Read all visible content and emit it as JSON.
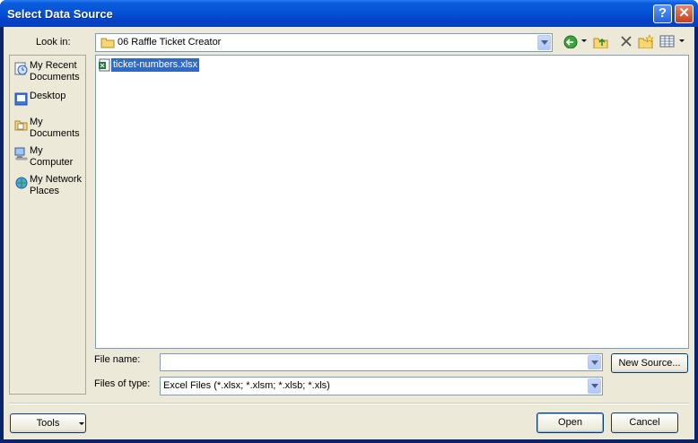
{
  "window": {
    "title": "Select Data Source",
    "help_label": "?",
    "close_label": "✕"
  },
  "look_in": {
    "label": "Look in:",
    "value": "06 Raffle Ticket Creator",
    "icon": "folder-icon"
  },
  "toolbar": {
    "back": "back-icon",
    "up": "up-folder-icon",
    "delete": "delete-icon",
    "new_folder": "new-folder-icon",
    "views": "views-icon"
  },
  "places_bar": [
    {
      "label": "My Recent Documents",
      "icon": "recent-documents-icon"
    },
    {
      "label": "Desktop",
      "icon": "desktop-icon"
    },
    {
      "label": "My Documents",
      "icon": "my-documents-icon"
    },
    {
      "label": "My Computer",
      "icon": "my-computer-icon"
    },
    {
      "label": "My Network Places",
      "icon": "network-places-icon"
    }
  ],
  "files": [
    {
      "name": "ticket-numbers.xlsx",
      "icon": "excel-file-icon",
      "selected": true
    }
  ],
  "file_name": {
    "label": "File name:",
    "value": ""
  },
  "files_of_type": {
    "label": "Files of type:",
    "value": "Excel Files (*.xlsx; *.xlsm; *.xlsb; *.xls)"
  },
  "buttons": {
    "new_source": "New Source...",
    "tools": "Tools",
    "open": "Open",
    "cancel": "Cancel"
  },
  "colors": {
    "title_bar": "#0552d6",
    "dialog_bg": "#ece9d8",
    "selection": "#316ac5"
  }
}
